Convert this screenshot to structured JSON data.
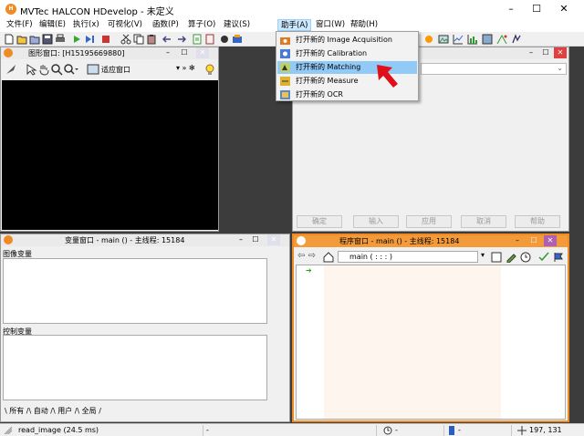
{
  "window": {
    "title": "MVTec HALCON HDevelop - 未定义",
    "minimize": "–",
    "maximize": "☐",
    "close": "✕"
  },
  "menubar": [
    "文件(F)",
    "编辑(E)",
    "执行(x)",
    "可视化(V)",
    "函数(P)",
    "算子(O)",
    "建议(S)",
    "助手(A)",
    "窗口(W)",
    "帮助(H)"
  ],
  "assistant_menu": {
    "items": [
      {
        "label": "打开新的 Image Acquisition",
        "icon": "camera-icon"
      },
      {
        "label": "打开新的 Calibration",
        "icon": "calibration-icon"
      },
      {
        "label": "打开新的 Matching",
        "icon": "matching-icon"
      },
      {
        "label": "打开新的 Measure",
        "icon": "measure-icon"
      },
      {
        "label": "打开新的 OCR",
        "icon": "ocr-icon"
      }
    ]
  },
  "graphics_window": {
    "title": "图形窗口: [H15195669880]",
    "zoom_label": "适应窗口"
  },
  "assistant_panel": {
    "buttons": [
      "确定",
      "输入",
      "应用",
      "取消",
      "帮助"
    ]
  },
  "variable_window": {
    "title": "变量窗口 - main () - 主线程: 15184",
    "iconic_label": "图像变量",
    "control_label": "控制变量",
    "tabs": "\\ 所有 /\\ 自动 /\\ 用户 /\\ 全局 /"
  },
  "program_window": {
    "title": "程序窗口 - main () - 主线程: 15184",
    "procedure": "main ( : : : )"
  },
  "statusbar": {
    "message": "read_image (24.5 ms)",
    "field2": "-",
    "field3": "-",
    "field4": "-",
    "coords": "197, 131"
  },
  "colors": {
    "accent_orange": "#f08a24",
    "highlight_blue": "#91c9f7",
    "dark_background": "#3c3c3c",
    "arrow_red": "#e0101a"
  }
}
